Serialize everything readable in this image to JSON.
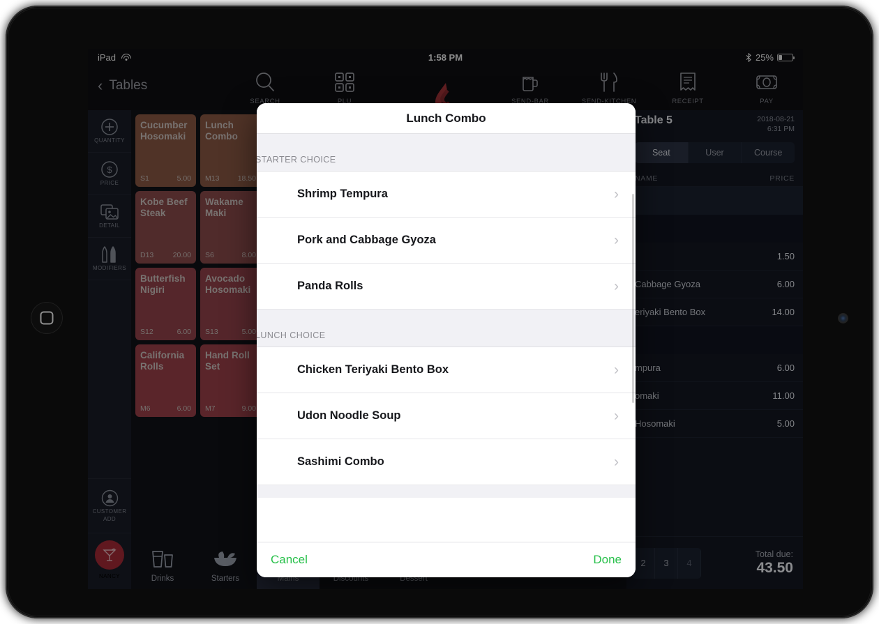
{
  "status_bar": {
    "device": "iPad",
    "wifi_icon": "wifi-icon",
    "time": "1:58 PM",
    "bluetooth_icon": "bluetooth-icon",
    "battery_percent": "25%",
    "battery_level": 25
  },
  "toolbar": {
    "back_label": "Tables",
    "items": [
      {
        "label": "SEARCH",
        "icon": "search-icon"
      },
      {
        "label": "PLU",
        "icon": "grid-icon"
      },
      {
        "label": "SEND-BAR",
        "icon": "beer-mug-icon"
      },
      {
        "label": "SEND-KITCHEN",
        "icon": "fork-knife-icon"
      },
      {
        "label": "RECEIPT",
        "icon": "receipt-icon"
      },
      {
        "label": "PAY",
        "icon": "banknote-icon"
      }
    ],
    "logo_icon": "lightspeed-flame-logo",
    "logo_color": "#a6353a"
  },
  "rail": {
    "items": [
      {
        "label": "QUANTITY",
        "icon": "plus-circle-icon"
      },
      {
        "label": "PRICE",
        "icon": "dollar-circle-icon"
      },
      {
        "label": "DETAIL",
        "icon": "images-icon"
      },
      {
        "label": "MODIFIERS",
        "icon": "shakers-icon"
      }
    ],
    "customer": {
      "label_line1": "CUSTOMER",
      "label_line2": "ADD",
      "icon": "person-circle-icon"
    },
    "user": {
      "label": "NANCY",
      "icon": "cocktail-icon",
      "avatar_color": "#a62a36"
    }
  },
  "grid": {
    "tiles": [
      {
        "name": "Cucumber Hosomaki",
        "code": "S1",
        "price": "5.00",
        "color": "#8a5844"
      },
      {
        "name": "Lunch Combo",
        "code": "M13",
        "price": "18.50",
        "color": "#8a5844"
      },
      {
        "name": "Kobe Beef Steak",
        "code": "D13",
        "price": "20.00",
        "color": "#8b4a4a"
      },
      {
        "name": "Wakame Maki",
        "code": "S6",
        "price": "8.00",
        "color": "#8b4a4a"
      },
      {
        "name": "Butterfish Nigiri",
        "code": "S12",
        "price": "6.00",
        "color": "#93434b"
      },
      {
        "name": "Avocado Hosomaki",
        "code": "S13",
        "price": "5.00",
        "color": "#93434b"
      },
      {
        "name": "California Rolls",
        "code": "M6",
        "price": "6.00",
        "color": "#9b4049"
      },
      {
        "name": "Hand Roll Set",
        "code": "M7",
        "price": "9.00",
        "color": "#9b4049"
      }
    ]
  },
  "categories": [
    {
      "label": "Drinks",
      "icon": "glasses-icon",
      "active": false
    },
    {
      "label": "Starters",
      "icon": "salad-bowl-icon",
      "active": false
    },
    {
      "label": "Mains",
      "icon": "plate-icon",
      "active": true
    },
    {
      "label": "Discounts",
      "icon": "percent-badge-icon",
      "active": false
    },
    {
      "label": "Dessert",
      "icon": "cake-slice-icon",
      "active": false
    }
  ],
  "order": {
    "title": "Table 5",
    "date": "2018-08-21",
    "time": "6:31 PM",
    "segments": [
      {
        "label": "Seat",
        "active": true
      },
      {
        "label": "User",
        "active": false
      },
      {
        "label": "Course",
        "active": false
      }
    ],
    "columns": {
      "name": "NAME",
      "price": "PRICE"
    },
    "rows": [
      {
        "name": "",
        "price": "",
        "type": "group"
      },
      {
        "name": "",
        "price": "",
        "type": "blank"
      },
      {
        "name": "",
        "price": "1.50",
        "type": "item"
      },
      {
        "name": "Cabbage Gyoza",
        "price": "6.00",
        "type": "item"
      },
      {
        "name": "eriyaki Bento Box",
        "price": "14.00",
        "type": "item"
      },
      {
        "name": "",
        "price": "",
        "type": "blank"
      },
      {
        "name": "mpura",
        "price": "6.00",
        "type": "item"
      },
      {
        "name": "omaki",
        "price": "11.00",
        "type": "item"
      },
      {
        "name": "Hosomaki",
        "price": "5.00",
        "type": "item"
      }
    ],
    "seats": [
      {
        "label": "2",
        "dim": false
      },
      {
        "label": "3",
        "dim": false
      },
      {
        "label": "4",
        "dim": true
      }
    ],
    "total_label": "Total due:",
    "total_value": "43.50"
  },
  "modal": {
    "title": "Lunch Combo",
    "sections": [
      {
        "header": "STARTER CHOICE",
        "options": [
          {
            "label": "Shrimp Tempura"
          },
          {
            "label": "Pork and Cabbage Gyoza"
          },
          {
            "label": "Panda Rolls"
          }
        ]
      },
      {
        "header": "LUNCH CHOICE",
        "options": [
          {
            "label": "Chicken Teriyaki Bento Box"
          },
          {
            "label": "Udon Noodle Soup"
          },
          {
            "label": "Sashimi Combo"
          }
        ]
      }
    ],
    "cancel_label": "Cancel",
    "done_label": "Done",
    "accent_color": "#27c04a"
  }
}
